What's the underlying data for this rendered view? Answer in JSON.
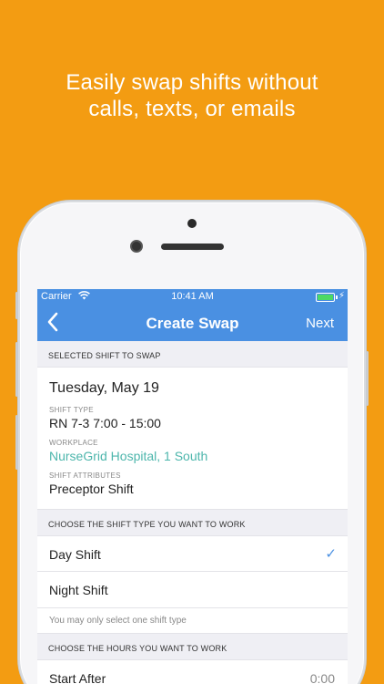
{
  "headline": {
    "line1": "Easily swap shifts without",
    "line2": "calls, texts, or emails"
  },
  "status_bar": {
    "carrier": "Carrier",
    "wifi_icon": "wifi-icon",
    "time": "10:41 AM",
    "battery_icon": "battery-icon"
  },
  "nav": {
    "back_icon": "chevron-left-icon",
    "title": "Create Swap",
    "next_label": "Next"
  },
  "selected_shift": {
    "section_title": "SELECTED SHIFT TO SWAP",
    "date": "Tuesday, May 19",
    "shift_type_label": "SHIFT TYPE",
    "shift_type": "RN 7-3 7:00 - 15:00",
    "workplace_label": "WORKPLACE",
    "workplace": "NurseGrid Hospital,  1 South",
    "attributes_label": "SHIFT ATTRIBUTES",
    "attributes": "Preceptor Shift"
  },
  "shift_type_choice": {
    "section_title": "CHOOSE THE SHIFT TYPE YOU WANT TO WORK",
    "options": [
      {
        "label": "Day Shift",
        "selected": true
      },
      {
        "label": "Night Shift",
        "selected": false
      }
    ],
    "hint": "You may only select one shift type"
  },
  "hours_choice": {
    "section_title": "CHOOSE THE HOURS YOU WANT TO WORK",
    "start_after_label": "Start After",
    "start_after_value": "0:00"
  },
  "colors": {
    "background": "#F39C12",
    "nav_blue": "#4A90E2",
    "workplace_green": "#4DB6AC",
    "check_blue": "#4A90E2"
  }
}
